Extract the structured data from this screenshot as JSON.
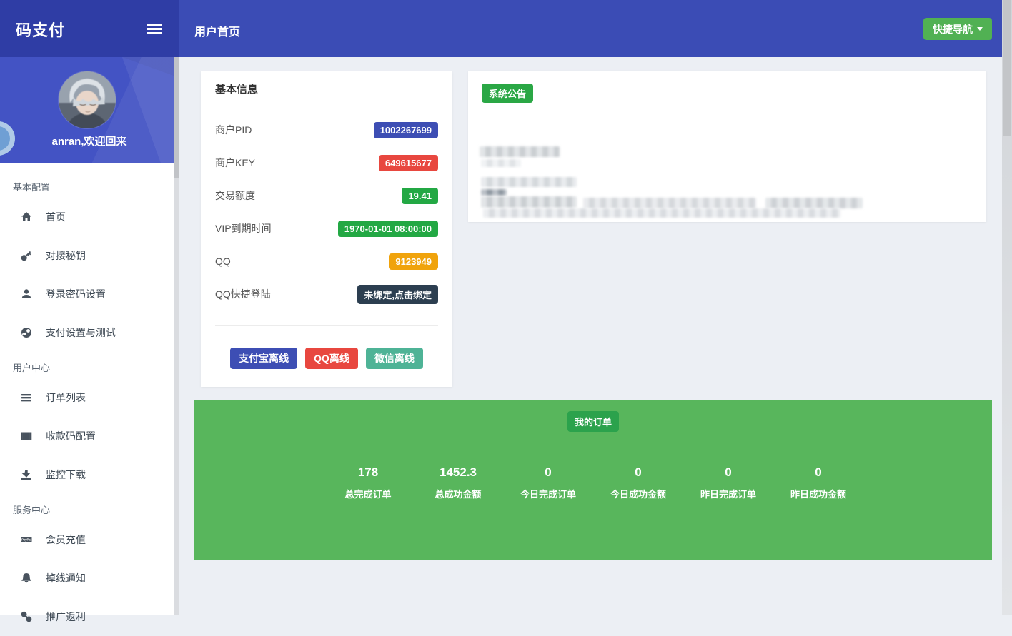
{
  "app": {
    "brand": "码支付",
    "page_title": "用户首页",
    "quick_nav_label": "快捷导航"
  },
  "sidebar": {
    "welcome": "anran,欢迎回来",
    "sections": [
      {
        "label": "基本配置",
        "items": [
          {
            "icon": "home",
            "label": "首页"
          },
          {
            "icon": "key",
            "label": "对接秘钥"
          },
          {
            "icon": "user",
            "label": "登录密码设置"
          },
          {
            "icon": "pay-test",
            "label": "支付设置与测试"
          }
        ]
      },
      {
        "label": "用户中心",
        "items": [
          {
            "icon": "list",
            "label": "订单列表"
          },
          {
            "icon": "barcode",
            "label": "收款码配置"
          },
          {
            "icon": "download",
            "label": "监控下载"
          }
        ]
      },
      {
        "label": "服务中心",
        "items": [
          {
            "icon": "paypal",
            "label": "会员充值"
          },
          {
            "icon": "bell",
            "label": "掉线通知"
          },
          {
            "icon": "link",
            "label": "推广返利"
          }
        ]
      }
    ]
  },
  "profile_card": {
    "title": "基本信息",
    "rows": [
      {
        "label": "商户PID",
        "value": "1002267699",
        "color": "#3d4eb4",
        "clickable": false
      },
      {
        "label": "商户KEY",
        "value": "649615677",
        "color": "#e8473f",
        "clickable": false
      },
      {
        "label": "交易额度",
        "value": "19.41",
        "color": "#23a844",
        "clickable": false
      },
      {
        "label": "VIP到期时间",
        "value": "1970-01-01 08:00:00",
        "color": "#23a844",
        "clickable": false
      },
      {
        "label": "QQ",
        "value": "9123949",
        "color": "#f0a30c",
        "clickable": false
      },
      {
        "label": "QQ快捷登陆",
        "value": "未绑定,点击绑定",
        "color": "#2c3e50",
        "clickable": true
      }
    ],
    "buttons": [
      {
        "label": "支付宝离线",
        "color": "#3d4eb4"
      },
      {
        "label": "QQ离线",
        "color": "#e8473f"
      },
      {
        "label": "微信离线",
        "color": "#4eb396"
      }
    ]
  },
  "announcement": {
    "badge": "系统公告"
  },
  "orders_panel": {
    "badge": "我的订单",
    "stats": [
      {
        "value": "178",
        "label": "总完成订单"
      },
      {
        "value": "1452.3",
        "label": "总成功金额"
      },
      {
        "value": "0",
        "label": "今日完成订单"
      },
      {
        "value": "0",
        "label": "今日成功金额"
      },
      {
        "value": "0",
        "label": "昨日完成订单"
      },
      {
        "value": "0",
        "label": "昨日成功金额"
      }
    ]
  },
  "colors": {
    "brand_dark_blue": "#2f3da5",
    "topbar_blue": "#3b4cb5",
    "user_panel_blue": "#4353c4",
    "quick_nav_green": "#51b153",
    "orders_panel_green": "#58b65c",
    "orders_badge_green": "#2ba24c",
    "announcement_badge_green": "#2aa745",
    "content_background": "#eceff4"
  }
}
